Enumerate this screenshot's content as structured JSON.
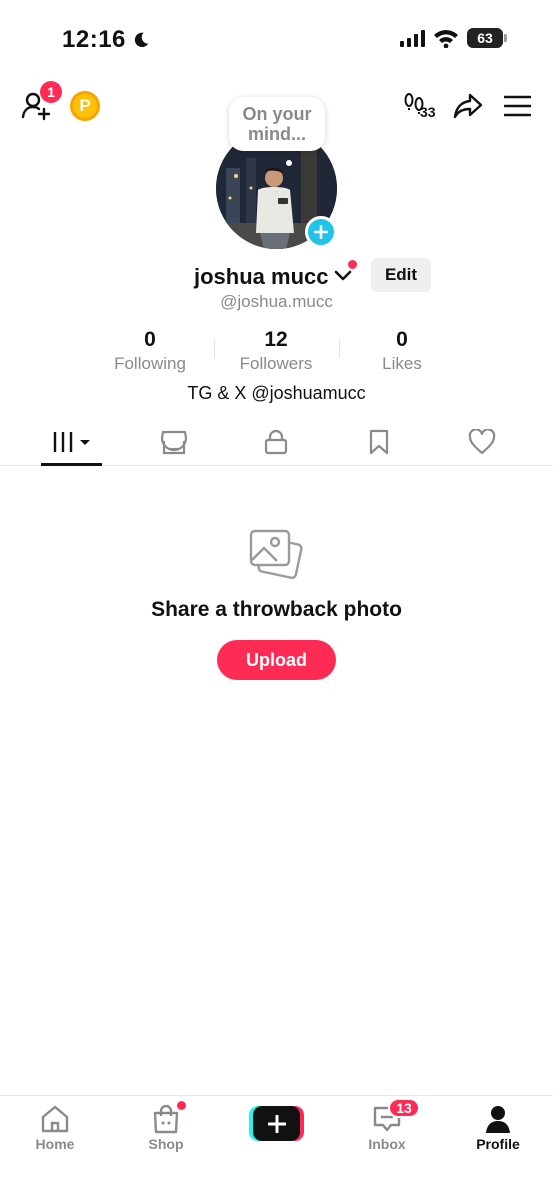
{
  "status_bar": {
    "time": "12:16",
    "battery": "63"
  },
  "header": {
    "friend_requests_count": "1",
    "coin_label": "P",
    "views_count": "33"
  },
  "thought_bubble": {
    "text": "On your mind..."
  },
  "profile": {
    "name": "joshua mucc",
    "handle": "@joshua.mucc",
    "edit_label": "Edit",
    "bio": "TG & X @joshuamucc",
    "stats": [
      {
        "value": "0",
        "label": "Following"
      },
      {
        "value": "12",
        "label": "Followers"
      },
      {
        "value": "0",
        "label": "Likes"
      }
    ]
  },
  "tabs": [
    {
      "icon": "grid-icon",
      "active": true
    },
    {
      "icon": "shop-icon",
      "active": false
    },
    {
      "icon": "lock-icon",
      "active": false
    },
    {
      "icon": "bookmark-icon",
      "active": false
    },
    {
      "icon": "heart-icon",
      "active": false
    }
  ],
  "empty_state": {
    "title": "Share a throwback photo",
    "button_label": "Upload"
  },
  "bottom_nav": {
    "home": "Home",
    "shop": "Shop",
    "inbox": "Inbox",
    "inbox_count": "13",
    "profile": "Profile"
  },
  "colors": {
    "accent": "#fe2c55",
    "cyan": "#25f4ee",
    "add_blue": "#21c4e9"
  }
}
